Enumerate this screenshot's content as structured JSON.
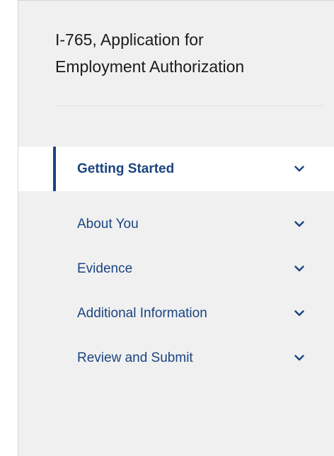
{
  "form": {
    "title_line1": "I-765, Application for",
    "title_line2": "Employment Authorization"
  },
  "nav": {
    "items": [
      {
        "label": "Getting Started",
        "active": true
      },
      {
        "label": "About You",
        "active": false
      },
      {
        "label": "Evidence",
        "active": false
      },
      {
        "label": "Additional Information",
        "active": false
      },
      {
        "label": "Review and Submit",
        "active": false
      }
    ],
    "accent_color": "#1a4480"
  }
}
